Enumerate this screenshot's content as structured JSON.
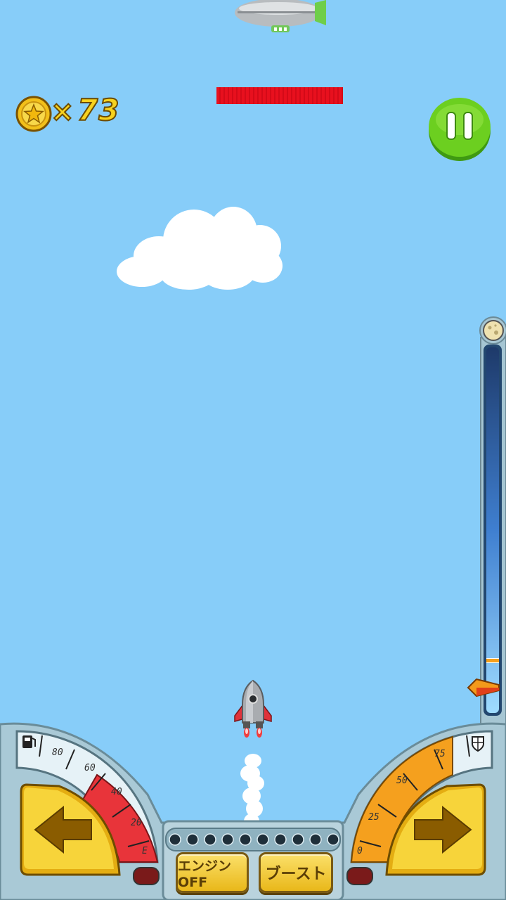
{
  "hud": {
    "coin_count": "73",
    "times_symbol": "×",
    "health_bar_fraction": 1.0,
    "health_bar_color": "#e8101e",
    "pause_icon": "pause-icon"
  },
  "altimeter": {
    "top_icon": "moon-icon",
    "rocket_marker_fraction": 0.07,
    "threshold_marker_fraction": 0.15
  },
  "fuel_gauge": {
    "icon": "fuel-pump-icon",
    "ticks": [
      "80",
      "60",
      "40",
      "20",
      "E"
    ]
  },
  "shield_gauge": {
    "icon": "shield-icon",
    "ticks": [
      "0",
      "25",
      "50",
      "75"
    ]
  },
  "controls": {
    "engine_off_label": "エンジンOFF",
    "boost_label": "ブースト",
    "left_icon": "arrow-left-icon",
    "right_icon": "arrow-right-icon"
  },
  "colors": {
    "sky": "#87cdf9",
    "panel": "#a9c9d6",
    "button_yellow": "#f3c623",
    "pause_green": "#5cc21a",
    "fuel_red": "#e8343a",
    "shield_orange": "#f5a01e"
  }
}
